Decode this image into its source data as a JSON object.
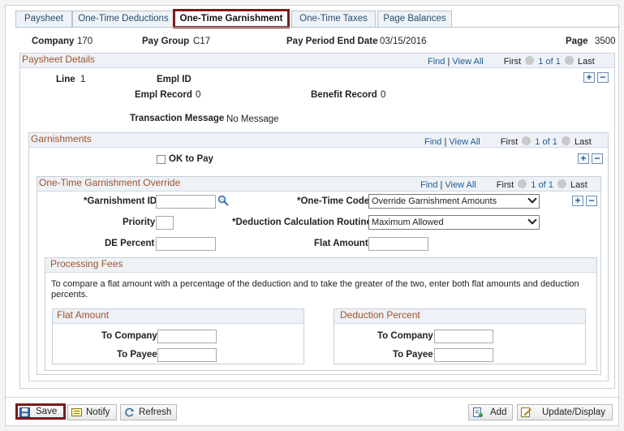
{
  "tabs": [
    {
      "label": "Paysheet"
    },
    {
      "label": "One-Time Deductions"
    },
    {
      "label": "One-Time Garnishment"
    },
    {
      "label": "One-Time Taxes"
    },
    {
      "label": "Page Balances"
    }
  ],
  "header": {
    "company_label": "Company",
    "company_value": "170",
    "paygroup_label": "Pay Group",
    "paygroup_value": "C17",
    "period_label": "Pay Period End Date",
    "period_value": "03/15/2016",
    "page_label": "Page",
    "page_value": "3500"
  },
  "paysheet": {
    "title": "Paysheet Details",
    "find": "Find",
    "viewall": "View All",
    "first": "First",
    "count": "1 of 1",
    "last": "Last",
    "line_label": "Line",
    "line_value": "1",
    "emplid_label": "Empl ID",
    "emplid_value": "",
    "emplrec_label": "Empl Record",
    "emplrec_value": "0",
    "benefit_label": "Benefit Record",
    "benefit_value": "0",
    "txn_label": "Transaction Message",
    "txn_value": "No Message"
  },
  "garnishments": {
    "title": "Garnishments",
    "find": "Find",
    "viewall": "View All",
    "first": "First",
    "count": "1 of 1",
    "last": "Last",
    "ok_to_pay": "OK to Pay"
  },
  "override": {
    "title": "One-Time Garnishment Override",
    "find": "Find",
    "viewall": "View All",
    "first": "First",
    "count": "1 of 1",
    "last": "Last",
    "garn_id_label": "*Garnishment ID",
    "onetime_code_label": "*One-Time Code",
    "onetime_code_value": "Override Garnishment Amounts",
    "priority_label": "Priority",
    "ded_calc_label": "*Deduction Calculation Routine",
    "ded_calc_value": "Maximum Allowed",
    "de_percent_label": "DE Percent",
    "flat_amount_label": "Flat Amount"
  },
  "fees": {
    "title": "Processing Fees",
    "description": "To compare a flat amount with a percentage of the deduction and to take the greater of the two, enter both flat amounts and deduction percents.",
    "flat_title": "Flat Amount",
    "pct_title": "Deduction Percent",
    "to_company": "To Company",
    "to_payee": "To Payee"
  },
  "buttons": {
    "save": "Save",
    "notify": "Notify",
    "refresh": "Refresh",
    "add": "Add",
    "update": "Update/Display"
  }
}
